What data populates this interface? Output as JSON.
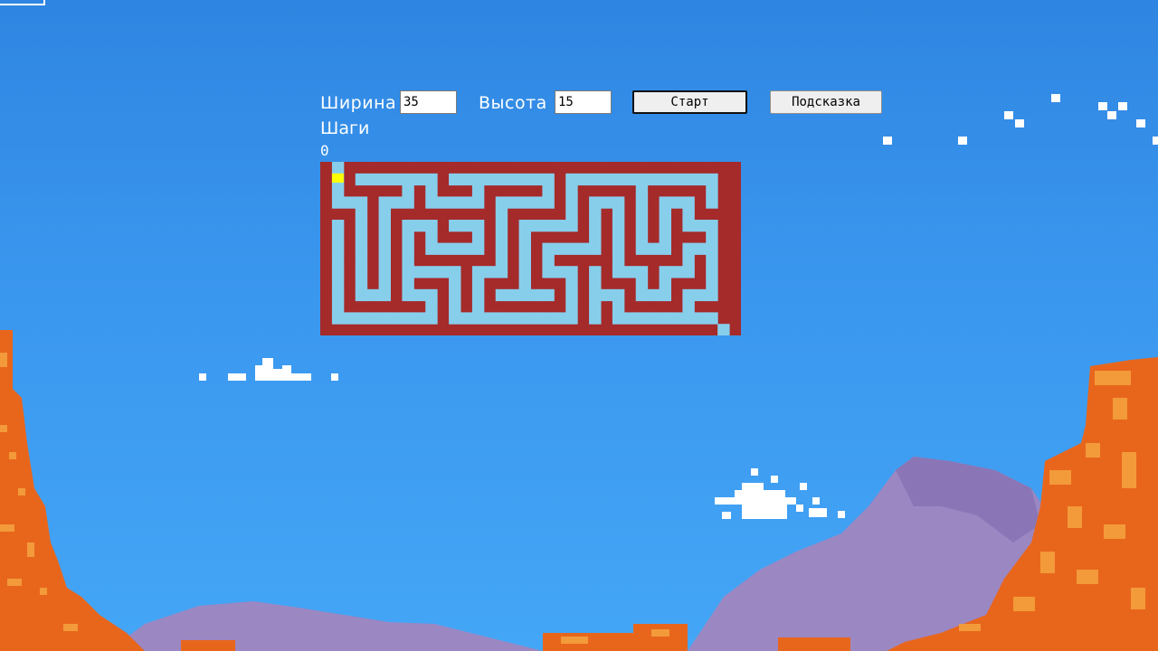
{
  "controls": {
    "width_label": "Ширина",
    "width_value": "35",
    "height_label": "Высота",
    "height_value": "15",
    "start_button": "Старт",
    "hint_button": "Подскaзка"
  },
  "steps": {
    "label": "Шаги",
    "value": "0"
  },
  "maze": {
    "cols": 35,
    "rows": 15,
    "wall_color": "#a52a2a",
    "path_color": "#87ceeb",
    "player_color": "#ffff00",
    "player_cell": [
      0,
      0
    ]
  },
  "colors": {
    "sky_top": "#2f86e2",
    "sky_bottom": "#44a6f6",
    "rock_orange": "#e8661c",
    "rock_light": "#f39a3a",
    "mountain_purple": "#9b87c2",
    "cloud": "#ffffff"
  }
}
